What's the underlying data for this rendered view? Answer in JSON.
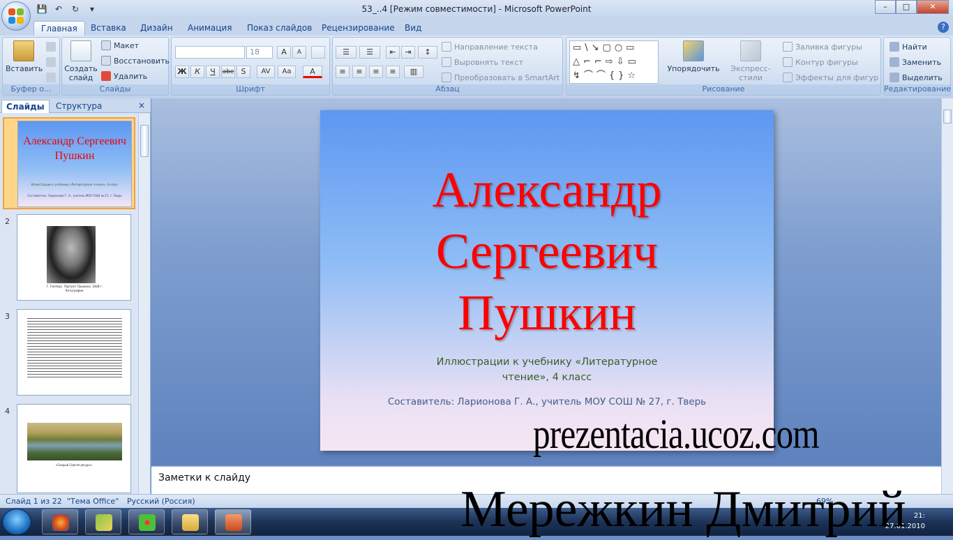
{
  "window": {
    "title": "53_..4 [Режим совместимости] - Microsoft PowerPoint",
    "minimize": "–",
    "maximize": "□",
    "close": "✕"
  },
  "qat": {
    "save": "💾",
    "undo": "↶",
    "redo": "↻",
    "more": "▾"
  },
  "tabs": [
    "Главная",
    "Вставка",
    "Дизайн",
    "Анимация",
    "Показ слайдов",
    "Рецензирование",
    "Вид"
  ],
  "help": "?",
  "ribbon": {
    "clipboard": {
      "paste": "Вставить",
      "label": "Буфер о..."
    },
    "slides": {
      "new_slide": "Создать слайд",
      "layout": "Макет",
      "reset": "Восстановить",
      "delete": "Удалить",
      "label": "Слайды"
    },
    "font": {
      "font_name": "",
      "font_size": "18",
      "label": "Шрифт",
      "bold": "Ж",
      "italic": "К",
      "underline": "Ч",
      "strike": "abe",
      "shadow": "S",
      "spacing": "AV",
      "case": "Aa",
      "color": "A",
      "grow": "A",
      "shrink": "A"
    },
    "paragraph": {
      "text_direction": "Направление текста",
      "align_text": "Выровнять текст",
      "smartart": "Преобразовать в SmartArt",
      "label": "Абзац"
    },
    "drawing": {
      "shapes": "▭\\↘▢○▭\n△⌐⌐⇨⇩▭\n↯⌒⌒{}☆",
      "arrange": "Упорядочить",
      "quick_styles": "Экспресс-стили",
      "fill": "Заливка фигуры",
      "outline": "Контур фигуры",
      "effects": "Эффекты для фигур",
      "label": "Рисование"
    },
    "editing": {
      "find": "Найти",
      "replace": "Заменить",
      "select": "Выделить",
      "label": "Редактирование"
    }
  },
  "left_pane": {
    "tab_slides": "Слайды",
    "tab_outline": "Структура",
    "close": "×",
    "thumbs": [
      {
        "num": "1",
        "title": "Александр Сергеевич Пушкин",
        "sub": "Иллюстрации к учебнику «Литературное чтение», 4 класс",
        "author": "Составитель: Ларионова Г. А., учитель МОУ СОШ № 27, г. Тверь"
      },
      {
        "num": "2",
        "caption": "Г. Гиппиус. Портрет Пушкина. 1828 г. Литография."
      },
      {
        "num": "3"
      },
      {
        "num": "4",
        "caption": "«Скорый Сергея ресурс»"
      }
    ]
  },
  "slide": {
    "title": "Александр Сергеевич Пушкин",
    "subtitle": "Иллюстрации к учебнику «Литературное чтение», 4 класс",
    "author": "Составитель: Ларионова Г. А., учитель МОУ СОШ № 27, г. Тверь"
  },
  "notes": "Заметки к слайду",
  "status": {
    "slide": "Слайд 1 из 22",
    "theme": "\"Тема Office\"",
    "lang": "Русский (Россия)",
    "zoom": "69%"
  },
  "taskbar": {
    "time": "21:",
    "date": "27.01.2010"
  },
  "watermarks": {
    "site": "prezentacia.ucoz.com",
    "author": "Мережкин Дмитрий"
  }
}
